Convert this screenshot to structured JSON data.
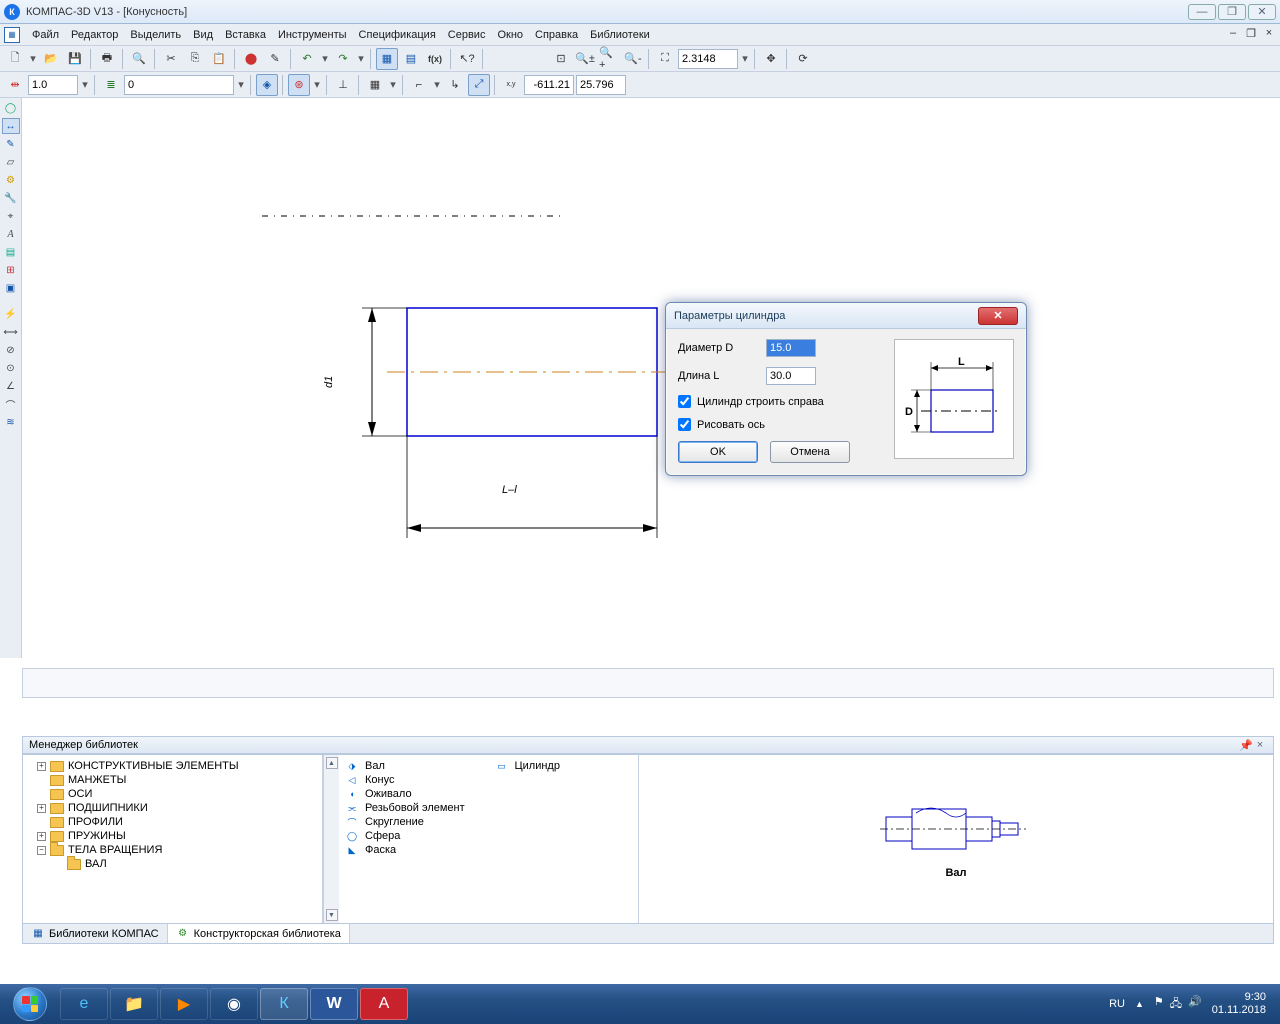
{
  "app": {
    "title": "КОМПАС-3D V13 - [Конусность]"
  },
  "menu": [
    "Файл",
    "Редактор",
    "Выделить",
    "Вид",
    "Вставка",
    "Инструменты",
    "Спецификация",
    "Сервис",
    "Окно",
    "Справка",
    "Библиотеки"
  ],
  "toolbar2": {
    "style_val": "1.0",
    "layer_val": "0",
    "coord_x": "-611.21",
    "coord_y": "25.796",
    "zoom_val": "2.3148"
  },
  "dialog": {
    "title": "Параметры цилиндра",
    "diameter_label": "Диаметр D",
    "diameter_val": "15.0",
    "length_label": "Длина L",
    "length_val": "30.0",
    "chk1": "Цилиндр строить справа",
    "chk2": "Рисовать ось",
    "ok": "OK",
    "cancel": "Отмена",
    "preview_L": "L",
    "preview_D": "D"
  },
  "drawing": {
    "dim_d1": "d1",
    "dim_Ll": "L–l"
  },
  "libmgr": {
    "title": "Менеджер библиотек",
    "tree": [
      "КОНСТРУКТИВНЫЕ ЭЛЕМЕНТЫ",
      "МАНЖЕТЫ",
      "ОСИ",
      "ПОДШИПНИКИ",
      "ПРОФИЛИ",
      "ПРУЖИНЫ",
      "ТЕЛА ВРАЩЕНИЯ"
    ],
    "tree_sub": "ВАЛ",
    "col1": [
      "Вал",
      "Конус",
      "Оживало",
      "Резьбовой элемент",
      "Скругление",
      "Сфера",
      "Фаска"
    ],
    "col2": [
      "Цилиндр"
    ],
    "preview_caption": "Вал",
    "tabs": [
      "Библиотеки КОМПАС",
      "Конструкторская библиотека"
    ]
  },
  "taskbar": {
    "lang": "RU",
    "time": "9:30",
    "date": "01.11.2018"
  }
}
